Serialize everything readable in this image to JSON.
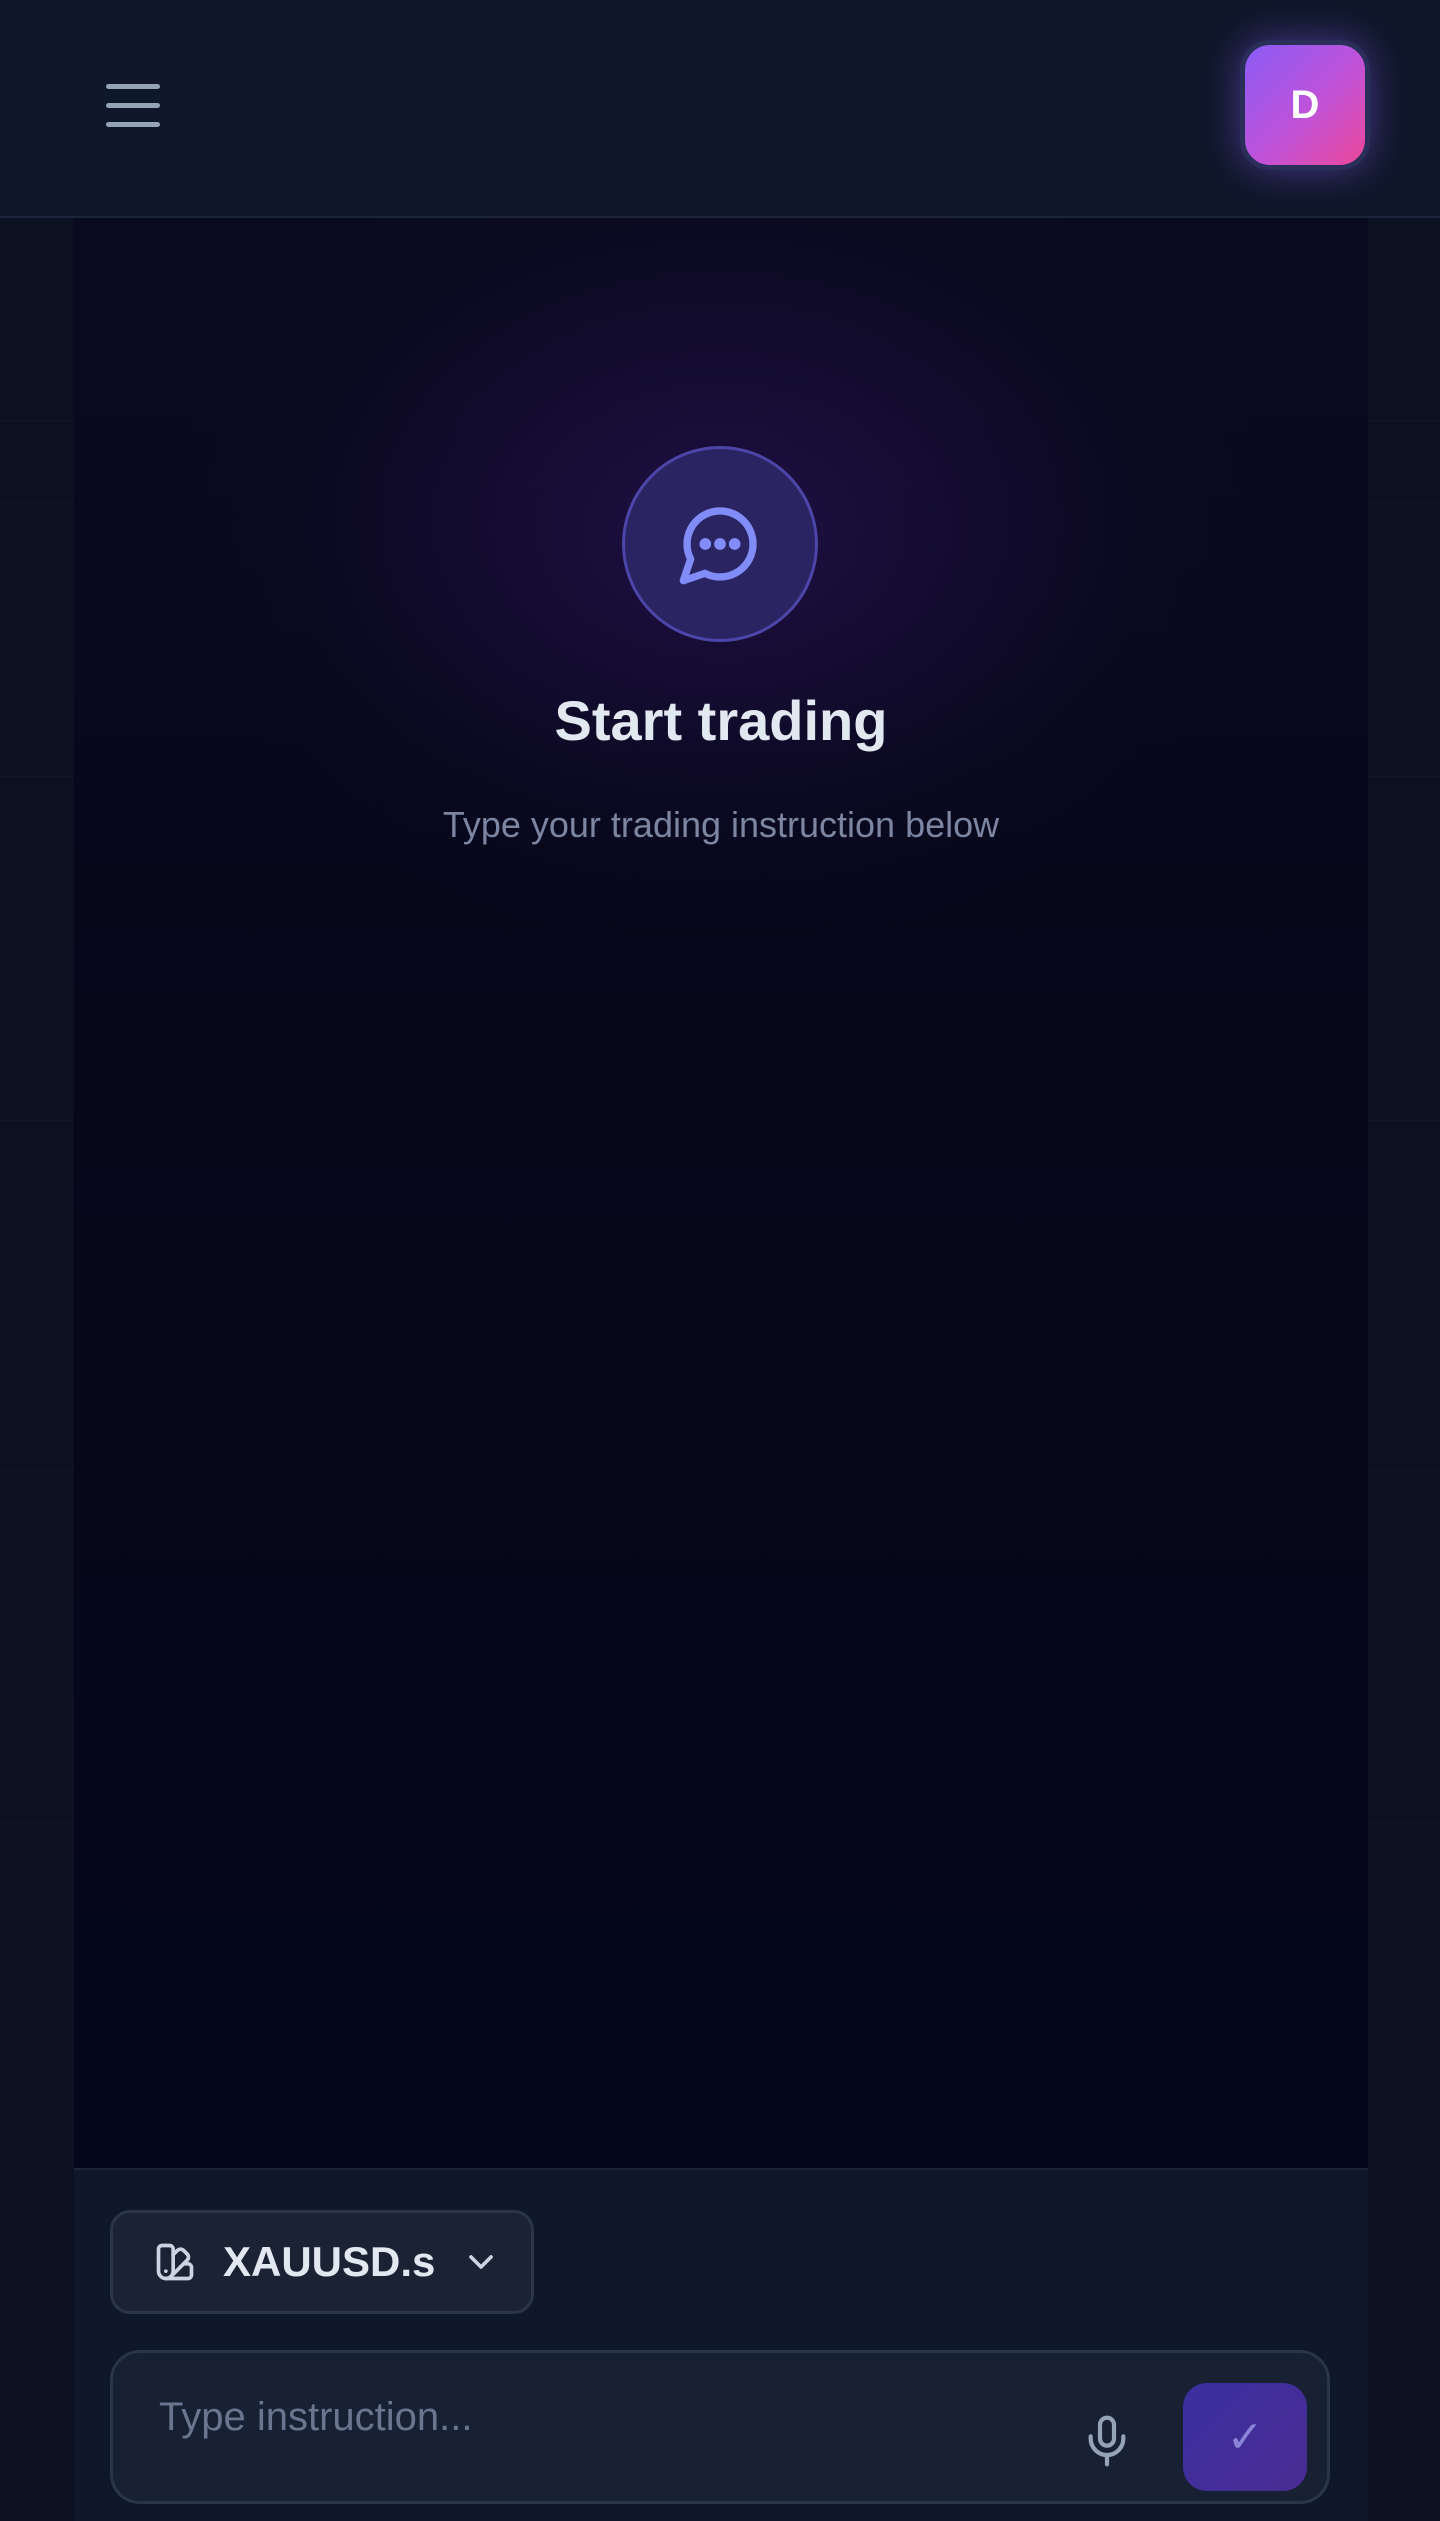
{
  "header": {
    "avatar_initial": "D"
  },
  "empty_state": {
    "title": "Start trading",
    "subtitle": "Type your trading instruction below"
  },
  "composer": {
    "symbol": "XAUUSD.s",
    "placeholder": "Type instruction...",
    "send_glyph": "✓"
  },
  "icons": {
    "menu": "hamburger-menu-icon",
    "chat": "message-bubble-icon",
    "symbol": "swatch-book-icon",
    "dropdown": "chevron-down-icon",
    "mic": "microphone-icon",
    "send": "checkmark-icon"
  },
  "colors": {
    "background": "#0b1120",
    "accent": "#8b5cf6",
    "accent_pink": "#ec4899",
    "icon_accent": "#818cf8",
    "muted_text": "#7c86a2"
  }
}
